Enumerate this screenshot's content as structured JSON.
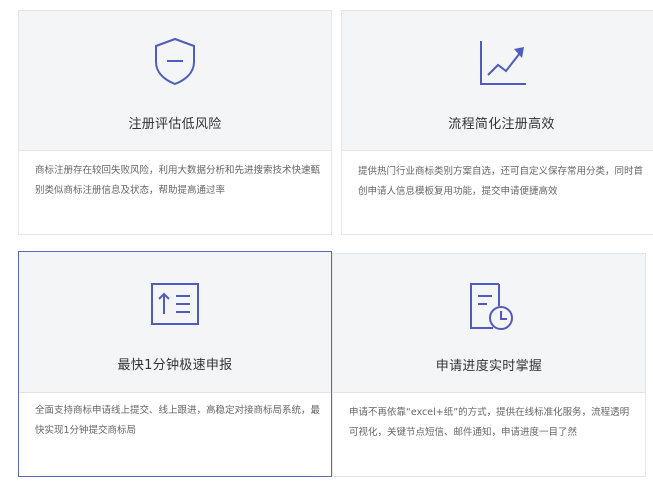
{
  "accent_color": "#4f5bbf",
  "cards": [
    {
      "icon": "shield-icon",
      "title": "注册评估低风险",
      "description": "商标注册存在较回失败风险，利用大数据分析和先进搜索技术快速甄别类似商标注册信息及状态，帮助提高通过率"
    },
    {
      "icon": "trend-chart-icon",
      "title": "流程简化注册高效",
      "description": "提供热门行业商标类别方案自选，还可自定义保存常用分类，同时首创申请人信息模板复用功能，提交申请便捷高效"
    },
    {
      "icon": "upload-list-icon",
      "title": "最快1分钟极速申报",
      "description": "全面支持商标申请线上提交、线上跟进，高稳定对接商标局系统，最快实现1分钟提交商标局"
    },
    {
      "icon": "document-clock-icon",
      "title": "申请进度实时掌握",
      "description": "申请不再依靠“excel+纸”的方式，提供在线标准化服务，流程透明可视化，关键节点短信、邮件通知，申请进度一目了然"
    }
  ]
}
